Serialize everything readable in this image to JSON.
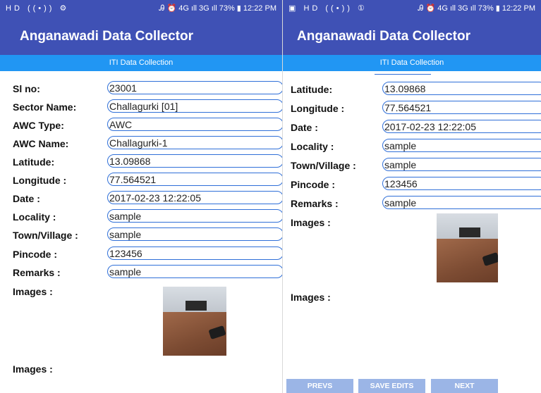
{
  "left": {
    "status": {
      "left": "HD ((•)) ⚙",
      "right": "Ꭿ ⏰ 4G ıll 3G ıll 73% ▮ 12:22 PM"
    },
    "app_title": "Anganawadi Data Collector",
    "section_title": "ITI Data Collection",
    "fields": [
      {
        "label": "Sl no:",
        "value": "23001"
      },
      {
        "label": "Sector Name:",
        "value": "Challagurki [01]"
      },
      {
        "label": "AWC Type:",
        "value": "AWC"
      },
      {
        "label": "AWC Name:",
        "value": "Challagurki-1"
      },
      {
        "label": "Latitude:",
        "value": "13.09868"
      },
      {
        "label": "Longitude :",
        "value": "77.564521"
      },
      {
        "label": "Date :",
        "value": "2017-02-23 12:22:05"
      },
      {
        "label": "Locality :",
        "value": "sample"
      },
      {
        "label": "Town/Village :",
        "value": "sample"
      },
      {
        "label": "Pincode :",
        "value": "123456"
      },
      {
        "label": "Remarks :",
        "value": "sample"
      }
    ],
    "images_label_1": "Images :",
    "images_label_2": "Images :"
  },
  "right": {
    "status": {
      "left": "▣ HD ((•)) ①",
      "right": "Ꭿ ⏰ 4G ıll 3G ıll 73% ▮ 12:22 PM"
    },
    "app_title": "Anganawadi Data Collector",
    "section_title": "ITI Data Collection",
    "fields": [
      {
        "label": "Latitude:",
        "value": "13.09868"
      },
      {
        "label": "Longitude :",
        "value": "77.564521"
      },
      {
        "label": "Date :",
        "value": "2017-02-23 12:22:05"
      },
      {
        "label": "Locality :",
        "value": "sample"
      },
      {
        "label": "Town/Village :",
        "value": "sample"
      },
      {
        "label": "Pincode :",
        "value": "123456"
      },
      {
        "label": "Remarks :",
        "value": "sample"
      }
    ],
    "images_label_1": "Images :",
    "images_label_2": "Images :",
    "buttons": {
      "prev": "PREVS",
      "save": "SAVE EDITS",
      "next": "NEXT"
    }
  },
  "colors": {
    "primary": "#3f51b5",
    "accent": "#2196f3",
    "field_border": "#2f6fd8",
    "button": "#9bb5e6"
  }
}
